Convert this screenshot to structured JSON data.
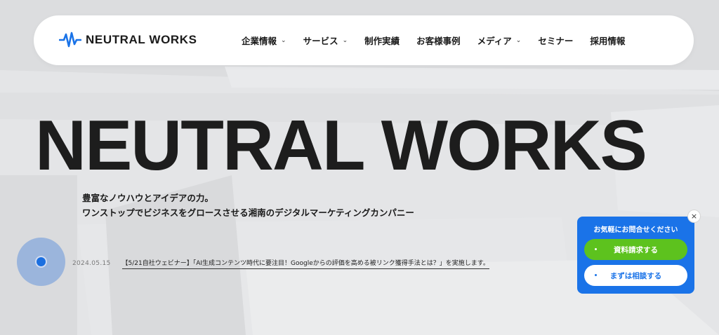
{
  "brand": {
    "name": "NEUTRAL WORKS",
    "logo_icon": "waveform-icon",
    "accent": "#1a73e8"
  },
  "nav": {
    "items": [
      {
        "label": "企業情報",
        "dropdown": true
      },
      {
        "label": "サービス",
        "dropdown": true
      },
      {
        "label": "制作実績",
        "dropdown": false
      },
      {
        "label": "お客様事例",
        "dropdown": false
      },
      {
        "label": "メディア",
        "dropdown": true
      },
      {
        "label": "セミナー",
        "dropdown": false
      },
      {
        "label": "採用情報",
        "dropdown": false
      }
    ],
    "chevron": "⌄"
  },
  "hero": {
    "title": "NEUTRAL WORKS",
    "tagline_line1": "豊富なノウハウとアイデアの力。",
    "tagline_line2": "ワンストップでビジネスをグロースさせる湘南のデジタルマーケティングカンパニー"
  },
  "news": {
    "date": "2024.05.15",
    "text": "【5/21自社ウェビナー】「AI生成コンテンツ時代に要注目！Googleからの評価を高める被リンク獲得手法とは？」を実施します。"
  },
  "contact": {
    "title": "お気軽にお問合せください",
    "request_button": "資料請求する",
    "consult_button": "まずは相談する",
    "close_symbol": "×",
    "colors": {
      "panel": "#1a73e8",
      "request": "#5dc21e"
    }
  }
}
